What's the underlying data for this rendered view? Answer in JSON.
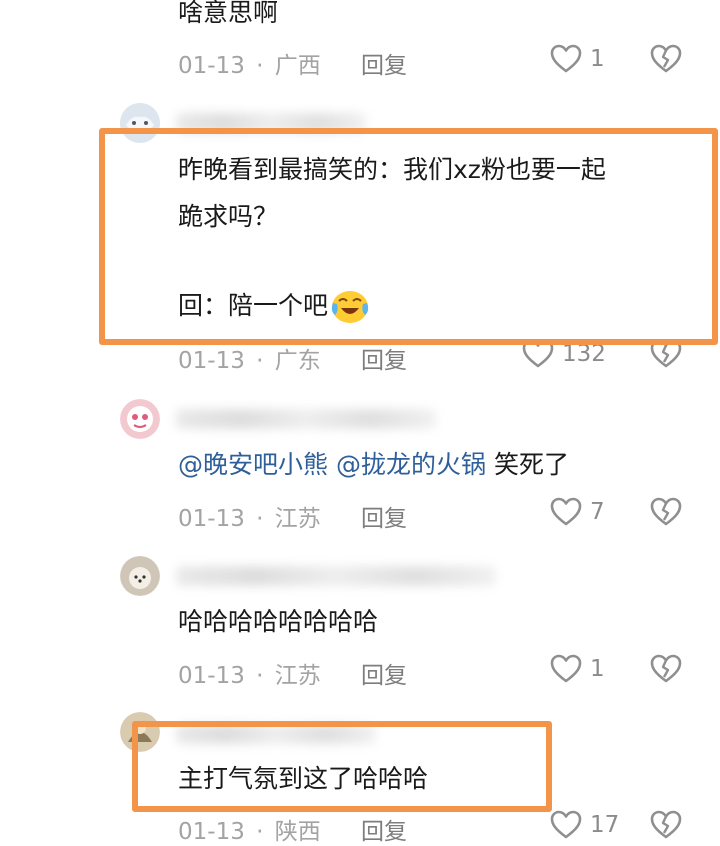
{
  "colors": {
    "highlight": "#f2944a",
    "mention": "#2f5f9a",
    "meta": "#a3a3a3",
    "icon": "#8f8f8f"
  },
  "comments": [
    {
      "text": "啥意思啊",
      "date": "01-13",
      "location": "广西",
      "reply_label": "回复",
      "likes": "1"
    },
    {
      "text_lines": [
        "昨晚看到最搞笑的：我们xz粉也要一起",
        "跪求吗？",
        "",
        "回：陪一个吧"
      ],
      "emoji": "crying-laughing-emoji",
      "date": "01-13",
      "location": "广东",
      "reply_label": "回复",
      "likes": "132"
    },
    {
      "mentions": [
        "@晚安吧小熊",
        "@拢龙的火锅"
      ],
      "text": "笑死了",
      "date": "01-13",
      "location": "江苏",
      "reply_label": "回复",
      "likes": "7"
    },
    {
      "text": "哈哈哈哈哈哈哈哈",
      "date": "01-13",
      "location": "江苏",
      "reply_label": "回复",
      "likes": "1"
    },
    {
      "text": "主打气氛到这了哈哈哈",
      "date": "01-13",
      "location": "陕西",
      "reply_label": "回复",
      "likes": "17"
    }
  ],
  "separator": "·",
  "icons": {
    "like": "heart-outline-icon",
    "dislike": "broken-heart-icon"
  }
}
